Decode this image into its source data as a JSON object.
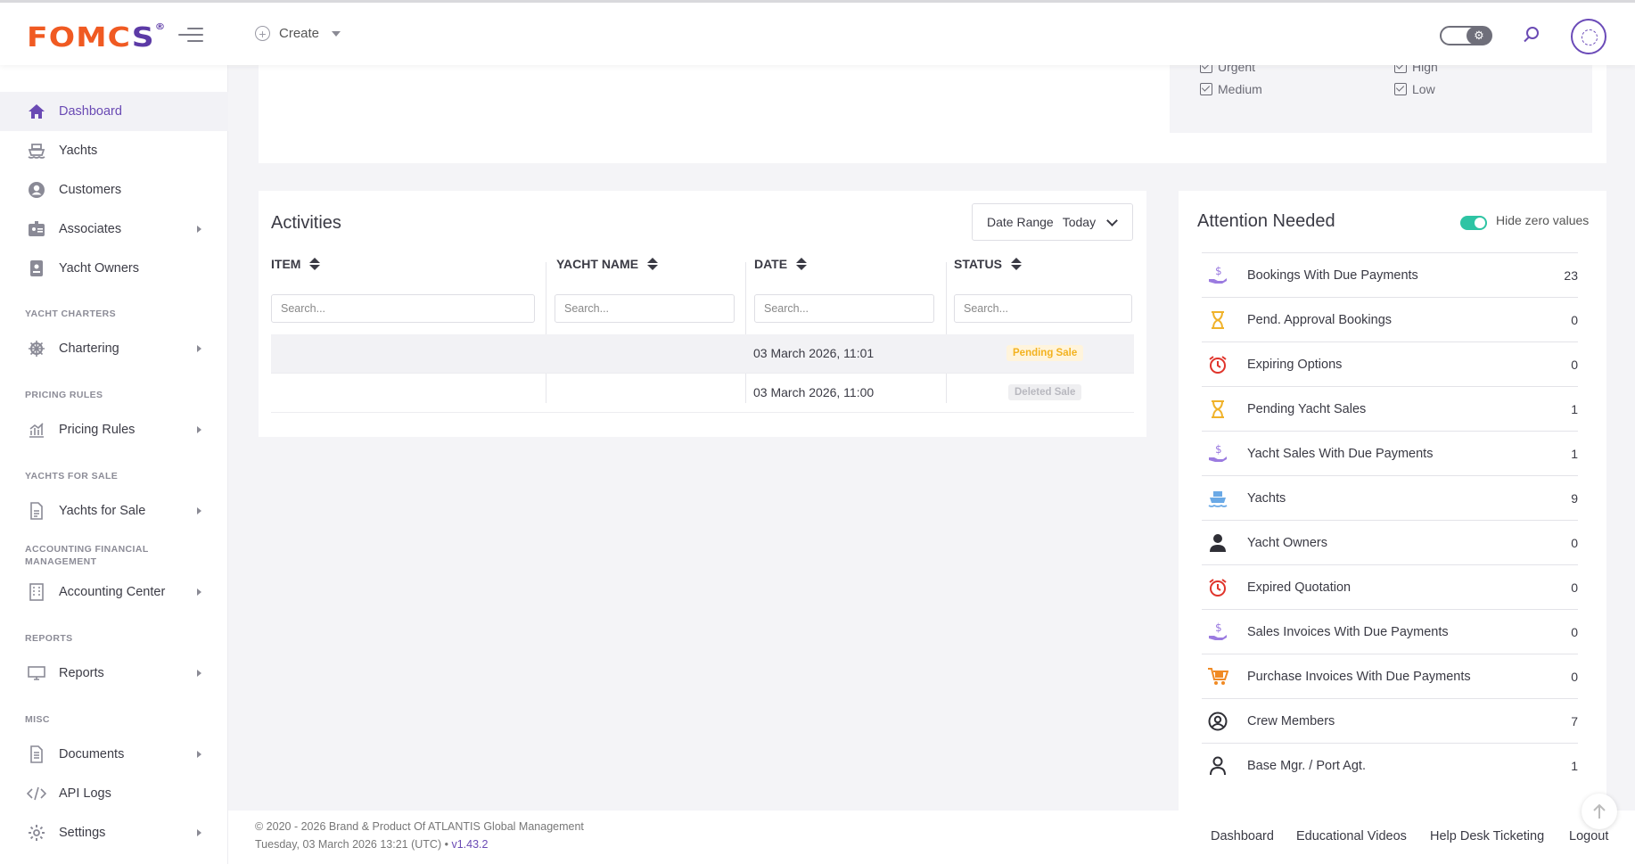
{
  "header": {
    "logo_main": "FOMC",
    "logo_accent": "S",
    "logo_mark": "®",
    "create_label": "Create"
  },
  "sidebar": {
    "items": [
      {
        "label": "Dashboard",
        "icon": "home-icon",
        "active": true
      },
      {
        "label": "Yachts",
        "icon": "ship-icon"
      },
      {
        "label": "Customers",
        "icon": "user-circle-icon"
      },
      {
        "label": "Associates",
        "icon": "id-card-icon",
        "has_submenu": true
      },
      {
        "label": "Yacht Owners",
        "icon": "badge-icon"
      },
      {
        "label": "Chartering",
        "icon": "helm-icon",
        "has_submenu": true
      },
      {
        "label": "Pricing Rules",
        "icon": "chart-icon",
        "has_submenu": true
      },
      {
        "label": "Yachts for Sale",
        "icon": "document-icon",
        "has_submenu": true
      },
      {
        "label": "Accounting Center",
        "icon": "building-icon",
        "has_submenu": true
      },
      {
        "label": "Reports",
        "icon": "monitor-icon",
        "has_submenu": true
      },
      {
        "label": "Documents",
        "icon": "file-icon",
        "has_submenu": true
      },
      {
        "label": "API Logs",
        "icon": "code-icon"
      },
      {
        "label": "Settings",
        "icon": "gear-icon",
        "has_submenu": true
      }
    ],
    "sections": [
      "Yacht Charters",
      "Pricing Rules",
      "Yachts For Sale",
      "Accounting Financial Management",
      "Reports",
      "Misc"
    ]
  },
  "priorities": {
    "urgent": "Urgent",
    "high": "High",
    "medium": "Medium",
    "low": "Low"
  },
  "activities": {
    "title": "Activities",
    "date_range_label": "Date Range",
    "date_range_value": "Today",
    "columns": [
      "ITEM",
      "YACHT NAME",
      "DATE",
      "STATUS"
    ],
    "search_placeholder": "Search...",
    "rows": [
      {
        "item": "",
        "yacht_name": "",
        "date": "03 March 2026, 11:01",
        "status": "Pending Sale",
        "status_color": "#f3b21f"
      },
      {
        "item": "",
        "yacht_name": "",
        "date": "03 March 2026, 11:00",
        "status": "Deleted Sale",
        "status_color": "#b8b8bf"
      }
    ]
  },
  "attention": {
    "title": "Attention Needed",
    "hide_zero_label": "Hide zero values",
    "hide_zero_enabled": true,
    "rows": [
      {
        "label": "Bookings With Due Payments",
        "count": "23",
        "icon": "hand-dollar-icon"
      },
      {
        "label": "Pend. Approval Bookings",
        "count": "0",
        "icon": "hourglass-icon"
      },
      {
        "label": "Expiring Options",
        "count": "0",
        "icon": "alarm-clock-icon"
      },
      {
        "label": "Pending Yacht Sales",
        "count": "1",
        "icon": "hourglass-icon"
      },
      {
        "label": "Yacht Sales With Due Payments",
        "count": "1",
        "icon": "hand-dollar-icon"
      },
      {
        "label": "Yachts",
        "count": "9",
        "icon": "ship-icon"
      },
      {
        "label": "Yacht Owners",
        "count": "0",
        "icon": "person-icon"
      },
      {
        "label": "Expired Quotation",
        "count": "0",
        "icon": "alarm-clock-icon"
      },
      {
        "label": "Sales Invoices With Due Payments",
        "count": "0",
        "icon": "hand-dollar-icon"
      },
      {
        "label": "Purchase Invoices With Due Payments",
        "count": "0",
        "icon": "cart-icon"
      },
      {
        "label": "Crew Members",
        "count": "7",
        "icon": "user-circle-icon"
      },
      {
        "label": "Base Mgr. / Port Agt.",
        "count": "1",
        "icon": "person-outline-icon"
      }
    ]
  },
  "footer": {
    "copyright": "© 2020 - 2026 Brand & Product Of ATLANTIS Global Management",
    "datetime": "Tuesday, 03 March 2026 13:21 (UTC) •",
    "version": "v1.43.2",
    "links": [
      "Dashboard",
      "Educational Videos",
      "Help Desk Ticketing",
      "Logout"
    ]
  },
  "colors": {
    "brand_orange": "#f05a22",
    "brand_purple": "#6a4ab4",
    "toggle_green": "#2ec4a4",
    "pending": "#f3b21f",
    "alarm_red": "#e0342b"
  }
}
